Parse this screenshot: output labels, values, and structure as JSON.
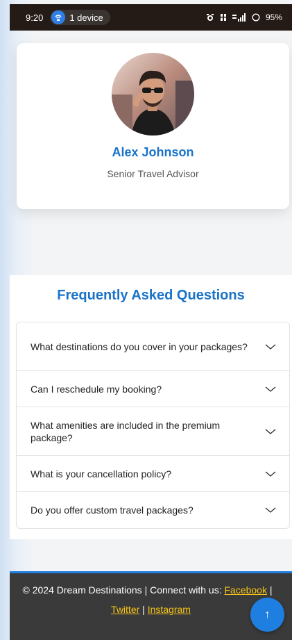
{
  "status_bar": {
    "time": "9:20",
    "device_pill": "1 device",
    "battery": "95%",
    "icons": [
      "alarm-icon",
      "volte-icon",
      "signal-icon",
      "battery-icon"
    ]
  },
  "profile": {
    "name": "Alex Johnson",
    "title": "Senior Travel Advisor"
  },
  "faq": {
    "heading": "Frequently Asked Questions",
    "items": [
      {
        "question": "What destinations do you cover in your packages?"
      },
      {
        "question": "Can I reschedule my booking?"
      },
      {
        "question": "What amenities are included in the premium package?"
      },
      {
        "question": "What is your cancellation policy?"
      },
      {
        "question": "Do you offer custom travel packages?"
      }
    ]
  },
  "footer": {
    "copyright": "© 2024 Dream Destinations | Connect with us: ",
    "links": [
      "Facebook",
      "Twitter",
      "Instagram"
    ],
    "separator": " | "
  },
  "scroll_top": {
    "symbol": "↑"
  },
  "colors": {
    "accent": "#1a73c9",
    "footer_bg": "#3a3a3a",
    "link": "#f5c518",
    "status_bar": "#241a16"
  }
}
